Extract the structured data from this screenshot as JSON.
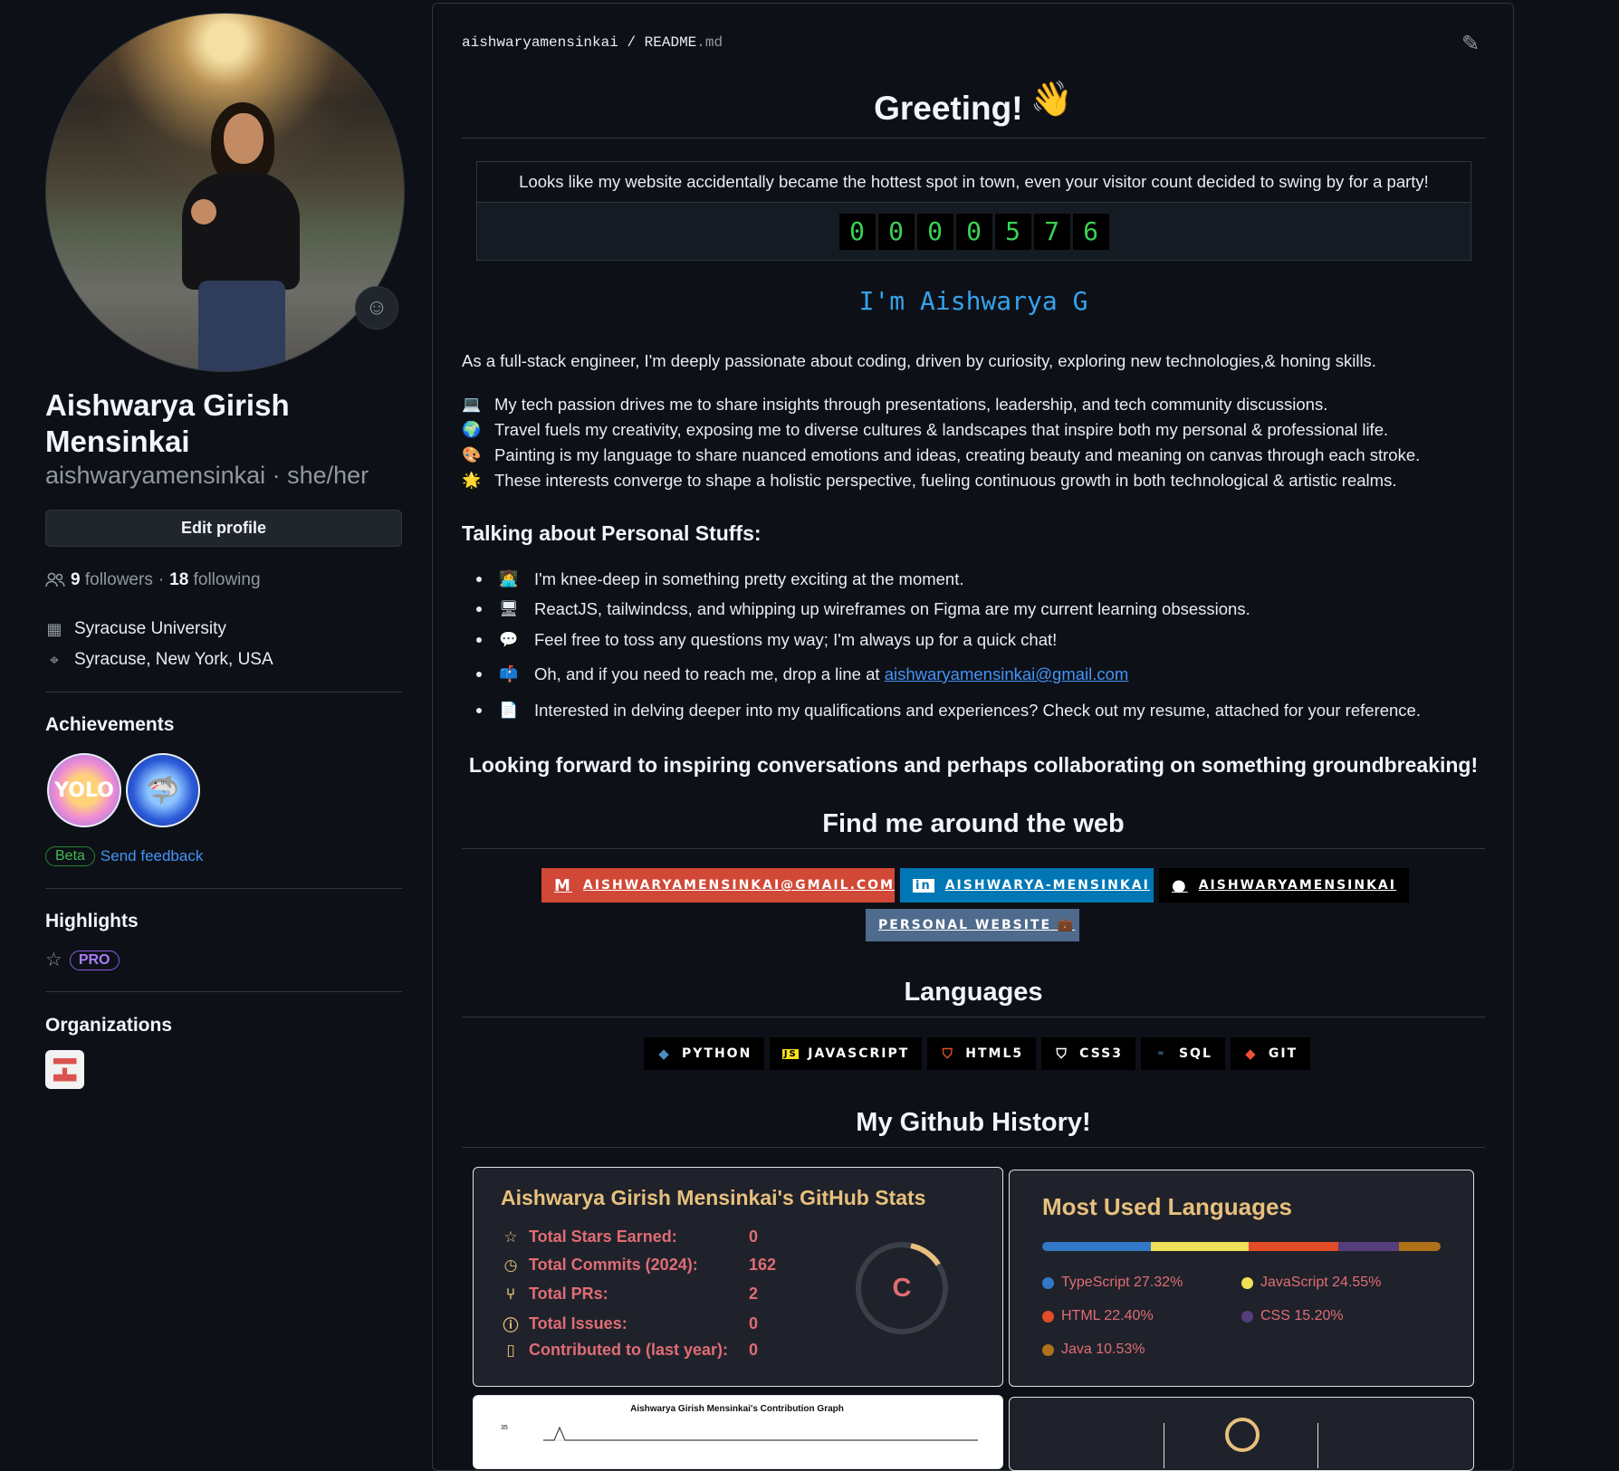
{
  "profile": {
    "full_name": "Aishwarya Girish Mensinkai",
    "login": "aishwaryamensinkai",
    "pronouns": "she/her",
    "login_line": "aishwaryamensinkai · she/her",
    "edit_profile_label": "Edit profile",
    "followers_count": "9",
    "followers_label": "followers",
    "separator": "·",
    "following_count": "18",
    "following_label": "following",
    "organization": "Syracuse University",
    "location": "Syracuse, New York, USA"
  },
  "achievements": {
    "heading": "Achievements",
    "badges": [
      "YOLO",
      "Shark"
    ],
    "beta_label": "Beta",
    "feedback_label": "Send feedback"
  },
  "highlights": {
    "heading": "Highlights",
    "pro_label": "PRO"
  },
  "organizations": {
    "heading": "Organizations"
  },
  "readme": {
    "path_owner": "aishwaryamensinkai",
    "path_sep": "/",
    "path_file": "README",
    "path_ext": ".md",
    "greeting": "Greeting!",
    "wave_emoji": "👋",
    "party_text": "Looks like my website accidentally became the hottest spot in town, even your visitor count decided to swing by for a party!",
    "visitor_counter": [
      "0",
      "0",
      "0",
      "0",
      "5",
      "7",
      "6"
    ],
    "im_line": "I'm Aishwarya G",
    "intro": "As a full-stack engineer, I'm deeply passionate about coding, driven by curiosity, exploring new technologies,& honing skills.",
    "passions": [
      {
        "icon": "💻",
        "text": "My tech passion drives me to share insights through presentations, leadership, and tech community discussions."
      },
      {
        "icon": "🌍",
        "text": "Travel fuels my creativity, exposing me to diverse cultures & landscapes that inspire both my personal & professional life."
      },
      {
        "icon": "🎨",
        "text": "Painting is my language to share nuanced emotions and ideas, creating beauty and meaning on canvas through each stroke."
      },
      {
        "icon": "🌟",
        "text": "These interests converge to shape a holistic perspective, fueling continuous growth in both technological & artistic realms."
      }
    ],
    "personal_heading": "Talking about Personal Stuffs:",
    "personal_items": [
      {
        "icon": "👩‍💻",
        "text": "I'm knee-deep in something pretty exciting at the moment."
      },
      {
        "icon": "🖥",
        "text": "ReactJS, tailwindcss, and whipping up wireframes on Figma are my current learning obsessions."
      },
      {
        "icon": "💬",
        "text": "Feel free to toss any questions my way; I'm always up for a quick chat!"
      },
      {
        "icon": "📫",
        "text": "Oh, and if you need to reach me, drop a line at "
      },
      {
        "icon": "📄",
        "text": "Interested in delving deeper into my qualifications and experiences? Check out my resume, attached for your reference."
      }
    ],
    "email_link": "aishwaryamensinkai@gmail.com",
    "looking_forward": "Looking forward to inspiring conversations and perhaps collaborating on something groundbreaking!",
    "find_me_heading": "Find me around the web",
    "web_links": {
      "gmail": "AISHWARYAMENSINKAI@GMAIL.COM",
      "linkedin": "AISHWARYA-MENSINKAI",
      "github": "AISHWARYAMENSINKAI",
      "website": "PERSONAL WEBSITE 💼"
    },
    "languages_heading": "Languages",
    "languages": [
      "PYTHON",
      "JAVASCRIPT",
      "HTML5",
      "CSS3",
      "SQL",
      "GIT"
    ],
    "history_heading": "My Github History!"
  },
  "github_stats": {
    "title": "Aishwarya Girish Mensinkai's GitHub Stats",
    "rows": [
      {
        "label": "Total Stars Earned:",
        "value": "0"
      },
      {
        "label": "Total Commits (2024):",
        "value": "162"
      },
      {
        "label": "Total PRs:",
        "value": "2"
      },
      {
        "label": "Total Issues:",
        "value": "0"
      },
      {
        "label": "Contributed to (last year):",
        "value": "0"
      }
    ],
    "rank": "C",
    "rank_progress": 0.1
  },
  "top_langs": {
    "title": "Most Used Languages",
    "items": [
      {
        "label": "TypeScript 27.32%",
        "percent": 27.32,
        "color": "#3178c6"
      },
      {
        "label": "JavaScript 24.55%",
        "percent": 24.55,
        "color": "#f1e05a"
      },
      {
        "label": "HTML 22.40%",
        "percent": 22.4,
        "color": "#e34c26"
      },
      {
        "label": "CSS 15.20%",
        "percent": 15.2,
        "color": "#563d7c"
      },
      {
        "label": "Java 10.53%",
        "percent": 10.53,
        "color": "#b07219"
      }
    ]
  },
  "contribution_graph": {
    "title": "Aishwarya Girish Mensinkai's Contribution Graph",
    "y_tick": "35"
  },
  "colors": {
    "background": "#0d1117",
    "link": "#4493f8",
    "stats_title": "#e8c07d",
    "stats_text": "#e06c75"
  }
}
